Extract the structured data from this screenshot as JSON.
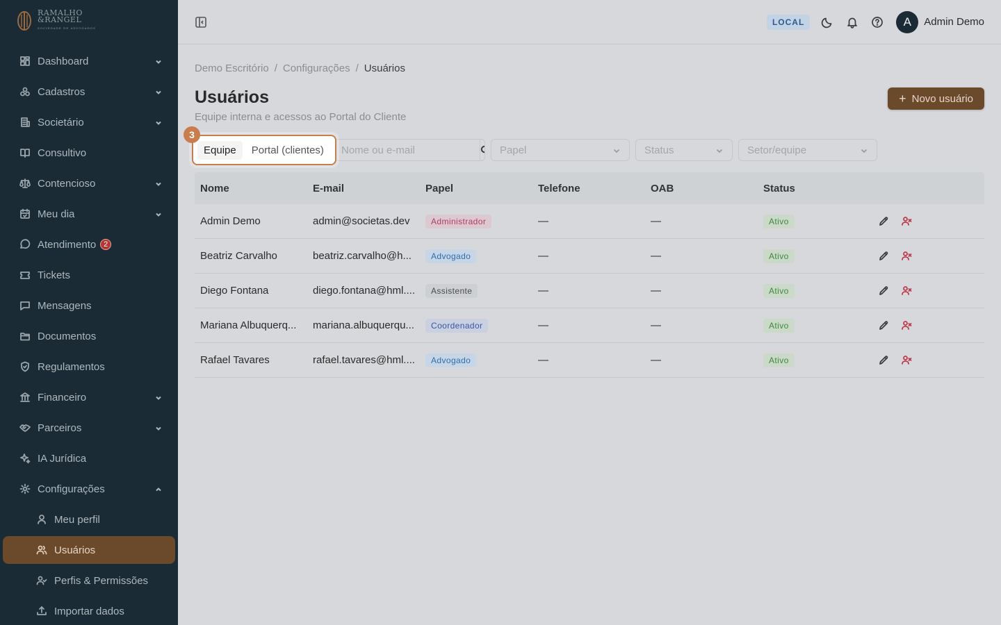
{
  "brand": {
    "line1": "RAMALHO",
    "line2": "&RANGEL",
    "tagline": "SOCIEDADE DE ADVOGADOS"
  },
  "sidebar": {
    "items": [
      {
        "label": "Dashboard",
        "icon": "dashboard-icon",
        "expandable": true
      },
      {
        "label": "Cadastros",
        "icon": "cadastros-icon",
        "expandable": true
      },
      {
        "label": "Societário",
        "icon": "building-icon",
        "expandable": true
      },
      {
        "label": "Consultivo",
        "icon": "book-icon",
        "expandable": false
      },
      {
        "label": "Contencioso",
        "icon": "scale-icon",
        "expandable": true
      },
      {
        "label": "Meu dia",
        "icon": "calendar-icon",
        "expandable": true
      },
      {
        "label": "Atendimento",
        "icon": "chat-icon",
        "expandable": false,
        "badge": "2"
      },
      {
        "label": "Tickets",
        "icon": "ticket-icon",
        "expandable": false
      },
      {
        "label": "Mensagens",
        "icon": "message-icon",
        "expandable": false
      },
      {
        "label": "Documentos",
        "icon": "folder-icon",
        "expandable": false
      },
      {
        "label": "Regulamentos",
        "icon": "shield-icon",
        "expandable": false
      },
      {
        "label": "Financeiro",
        "icon": "bank-icon",
        "expandable": true
      },
      {
        "label": "Parceiros",
        "icon": "handshake-icon",
        "expandable": true
      },
      {
        "label": "IA Jurídica",
        "icon": "sparkles-icon",
        "expandable": false
      },
      {
        "label": "Configurações",
        "icon": "gear-icon",
        "expandable": true,
        "expanded": true
      }
    ],
    "sub_items": [
      {
        "label": "Meu perfil",
        "icon": "user-icon"
      },
      {
        "label": "Usuários",
        "icon": "users-icon",
        "active": true
      },
      {
        "label": "Perfis & Permissões",
        "icon": "user-check-icon"
      },
      {
        "label": "Importar dados",
        "icon": "upload-icon"
      }
    ]
  },
  "topbar": {
    "env": "LOCAL",
    "avatar_initial": "A",
    "user_name": "Admin Demo"
  },
  "breadcrumb": [
    "Demo Escritório",
    "Configurações",
    "Usuários"
  ],
  "page": {
    "title": "Usuários",
    "subtitle": "Equipe interna e acessos ao Portal do Cliente",
    "new_button": "Novo usuário"
  },
  "filters": {
    "tabs": [
      "Equipe",
      "Portal (clientes)"
    ],
    "active_tab": "Equipe",
    "step": "3",
    "search_placeholder": "Nome ou e-mail",
    "role_placeholder": "Papel",
    "status_placeholder": "Status",
    "sector_placeholder": "Setor/equipe"
  },
  "table": {
    "headers": [
      "Nome",
      "E-mail",
      "Papel",
      "Telefone",
      "OAB",
      "Status"
    ],
    "rows": [
      {
        "name": "Admin Demo",
        "email": "admin@societas.dev",
        "role": "Administrador",
        "role_kind": "admin",
        "phone": "—",
        "oab": "—",
        "status": "Ativo"
      },
      {
        "name": "Beatriz Carvalho",
        "email": "beatriz.carvalho@h...",
        "role": "Advogado",
        "role_kind": "adv",
        "phone": "—",
        "oab": "—",
        "status": "Ativo"
      },
      {
        "name": "Diego Fontana",
        "email": "diego.fontana@hml....",
        "role": "Assistente",
        "role_kind": "assist",
        "phone": "—",
        "oab": "—",
        "status": "Ativo"
      },
      {
        "name": "Mariana Albuquerq...",
        "email": "mariana.albuquerqu...",
        "role": "Coordenador",
        "role_kind": "coord",
        "phone": "—",
        "oab": "—",
        "status": "Ativo"
      },
      {
        "name": "Rafael Tavares",
        "email": "rafael.tavares@hml....",
        "role": "Advogado",
        "role_kind": "adv",
        "phone": "—",
        "oab": "—",
        "status": "Ativo"
      }
    ]
  },
  "colors": {
    "sidebar_bg": "#1a2b35",
    "accent": "#6b4a2c",
    "highlight": "#c97c4c"
  }
}
